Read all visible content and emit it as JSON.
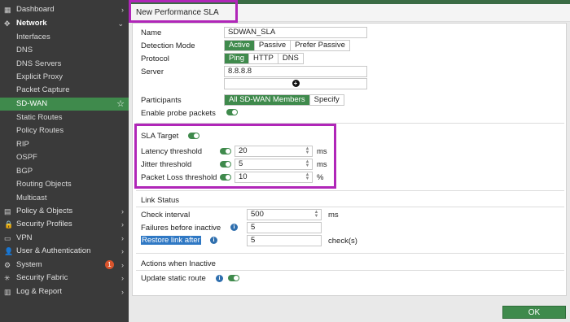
{
  "sidebar": {
    "items": [
      {
        "label": "Dashboard",
        "icon": "dashboard-icon",
        "chevron": "›",
        "type": "top"
      },
      {
        "label": "Network",
        "icon": "network-icon",
        "chevron": "⌄",
        "type": "top-open"
      },
      {
        "label": "Interfaces",
        "type": "sub"
      },
      {
        "label": "DNS",
        "type": "sub"
      },
      {
        "label": "DNS Servers",
        "type": "sub"
      },
      {
        "label": "Explicit Proxy",
        "type": "sub"
      },
      {
        "label": "Packet Capture",
        "type": "sub"
      },
      {
        "label": "SD-WAN",
        "type": "active",
        "star": "☆"
      },
      {
        "label": "Static Routes",
        "type": "sub"
      },
      {
        "label": "Policy Routes",
        "type": "sub"
      },
      {
        "label": "RIP",
        "type": "sub"
      },
      {
        "label": "OSPF",
        "type": "sub"
      },
      {
        "label": "BGP",
        "type": "sub"
      },
      {
        "label": "Routing Objects",
        "type": "sub"
      },
      {
        "label": "Multicast",
        "type": "sub"
      },
      {
        "label": "Policy & Objects",
        "icon": "policy-icon",
        "chevron": "›",
        "type": "top"
      },
      {
        "label": "Security Profiles",
        "icon": "security-profiles-icon",
        "chevron": "›",
        "type": "top"
      },
      {
        "label": "VPN",
        "icon": "vpn-icon",
        "chevron": "›",
        "type": "top"
      },
      {
        "label": "User & Authentication",
        "icon": "user-icon",
        "chevron": "›",
        "type": "top"
      },
      {
        "label": "System",
        "icon": "gear-icon",
        "chevron": "›",
        "type": "top",
        "badge": "1"
      },
      {
        "label": "Security Fabric",
        "icon": "fabric-icon",
        "chevron": "›",
        "type": "top"
      },
      {
        "label": "Log & Report",
        "icon": "log-icon",
        "chevron": "›",
        "type": "top"
      }
    ]
  },
  "page": {
    "title": "New Performance SLA"
  },
  "form": {
    "name_label": "Name",
    "name_value": "SDWAN_SLA",
    "detection_label": "Detection Mode",
    "detection_options": [
      "Active",
      "Passive",
      "Prefer Passive"
    ],
    "detection_selected": "Active",
    "protocol_label": "Protocol",
    "protocol_options": [
      "Ping",
      "HTTP",
      "DNS"
    ],
    "protocol_selected": "Ping",
    "server_label": "Server",
    "server_value": "8.8.8.8",
    "add_icon": "plus-circle-icon",
    "participants_label": "Participants",
    "participants_options": [
      "All SD-WAN Members",
      "Specify"
    ],
    "participants_selected": "All SD-WAN Members",
    "probe_label": "Enable probe packets",
    "probe_enabled": true
  },
  "sla_target": {
    "title": "SLA Target",
    "enabled": true,
    "latency_label": "Latency threshold",
    "latency_value": "20",
    "latency_unit": "ms",
    "jitter_label": "Jitter threshold",
    "jitter_value": "5",
    "jitter_unit": "ms",
    "loss_label": "Packet Loss threshold",
    "loss_value": "10",
    "loss_unit": "%"
  },
  "link_status": {
    "title": "Link Status",
    "check_label": "Check interval",
    "check_value": "500",
    "check_unit": "ms",
    "failures_label": "Failures before inactive",
    "failures_value": "5",
    "restore_label": "Restore link after",
    "restore_value": "5",
    "restore_unit": "check(s)"
  },
  "actions": {
    "title": "Actions when Inactive",
    "update_label": "Update static route",
    "update_enabled": true
  },
  "footer": {
    "ok_label": "OK"
  },
  "colors": {
    "accent": "#3f8a4c",
    "highlight": "#b026b8",
    "sidebar_bg": "#3a3a3a"
  }
}
